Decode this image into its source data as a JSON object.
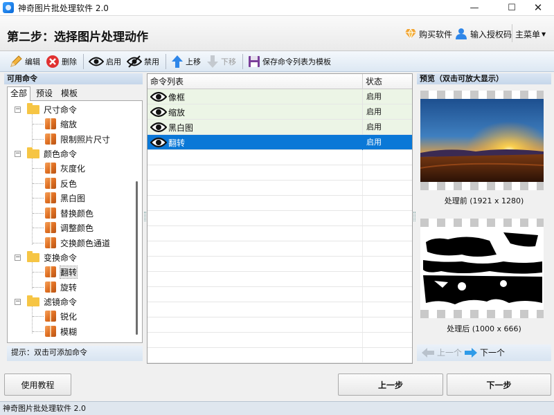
{
  "window": {
    "title": "神奇图片批处理软件 2.0",
    "min_icon": "minimize-icon",
    "max_icon": "maximize-icon",
    "close_icon": "close-icon"
  },
  "header": {
    "step_title": "第二步：选择图片处理动作",
    "buy_label": "购买软件",
    "license_label": "输入授权码",
    "menu_label": "主菜单"
  },
  "toolbar": {
    "edit": "编辑",
    "delete": "删除",
    "enable": "启用",
    "disable": "禁用",
    "move_up": "上移",
    "move_down": "下移",
    "save_template": "保存命令列表为模板"
  },
  "left": {
    "header": "可用命令",
    "tabs": [
      "全部",
      "预设",
      "模板"
    ],
    "tree": [
      {
        "label": "尺寸命令",
        "kind": "folder"
      },
      {
        "label": "缩放",
        "kind": "item"
      },
      {
        "label": "限制照片尺寸",
        "kind": "item"
      },
      {
        "label": "颜色命令",
        "kind": "folder"
      },
      {
        "label": "灰度化",
        "kind": "item"
      },
      {
        "label": "反色",
        "kind": "item"
      },
      {
        "label": "黑白图",
        "kind": "item"
      },
      {
        "label": "替换颜色",
        "kind": "item"
      },
      {
        "label": "调整颜色",
        "kind": "item"
      },
      {
        "label": "交换颜色通道",
        "kind": "item"
      },
      {
        "label": "变换命令",
        "kind": "folder"
      },
      {
        "label": "翻转",
        "kind": "item",
        "selected": true
      },
      {
        "label": "旋转",
        "kind": "item"
      },
      {
        "label": "滤镜命令",
        "kind": "folder"
      },
      {
        "label": "锐化",
        "kind": "item"
      },
      {
        "label": "模糊",
        "kind": "item"
      }
    ],
    "hint": "提示：双击可添加命令"
  },
  "commands": {
    "col_name": "命令列表",
    "col_status": "状态",
    "rows": [
      {
        "name": "像框",
        "status": "启用"
      },
      {
        "name": "缩放",
        "status": "启用"
      },
      {
        "name": "黑白图",
        "status": "启用"
      },
      {
        "name": "翻转",
        "status": "启用",
        "selected": true
      }
    ]
  },
  "preview": {
    "header": "预览（双击可放大显示）",
    "before_caption": "处理前 (1921 x 1280)",
    "after_caption": "处理后 (1000 x 666)",
    "prev_label": "上一个",
    "next_label": "下一个"
  },
  "bottom": {
    "tutorial": "使用教程",
    "prev_step": "上一步",
    "next_step": "下一步"
  },
  "status": {
    "text": "神奇图片批处理软件 2.0"
  },
  "colors": {
    "selection": "#0a78d7",
    "folder": "#f6c544",
    "accent": "#2f86e8"
  }
}
